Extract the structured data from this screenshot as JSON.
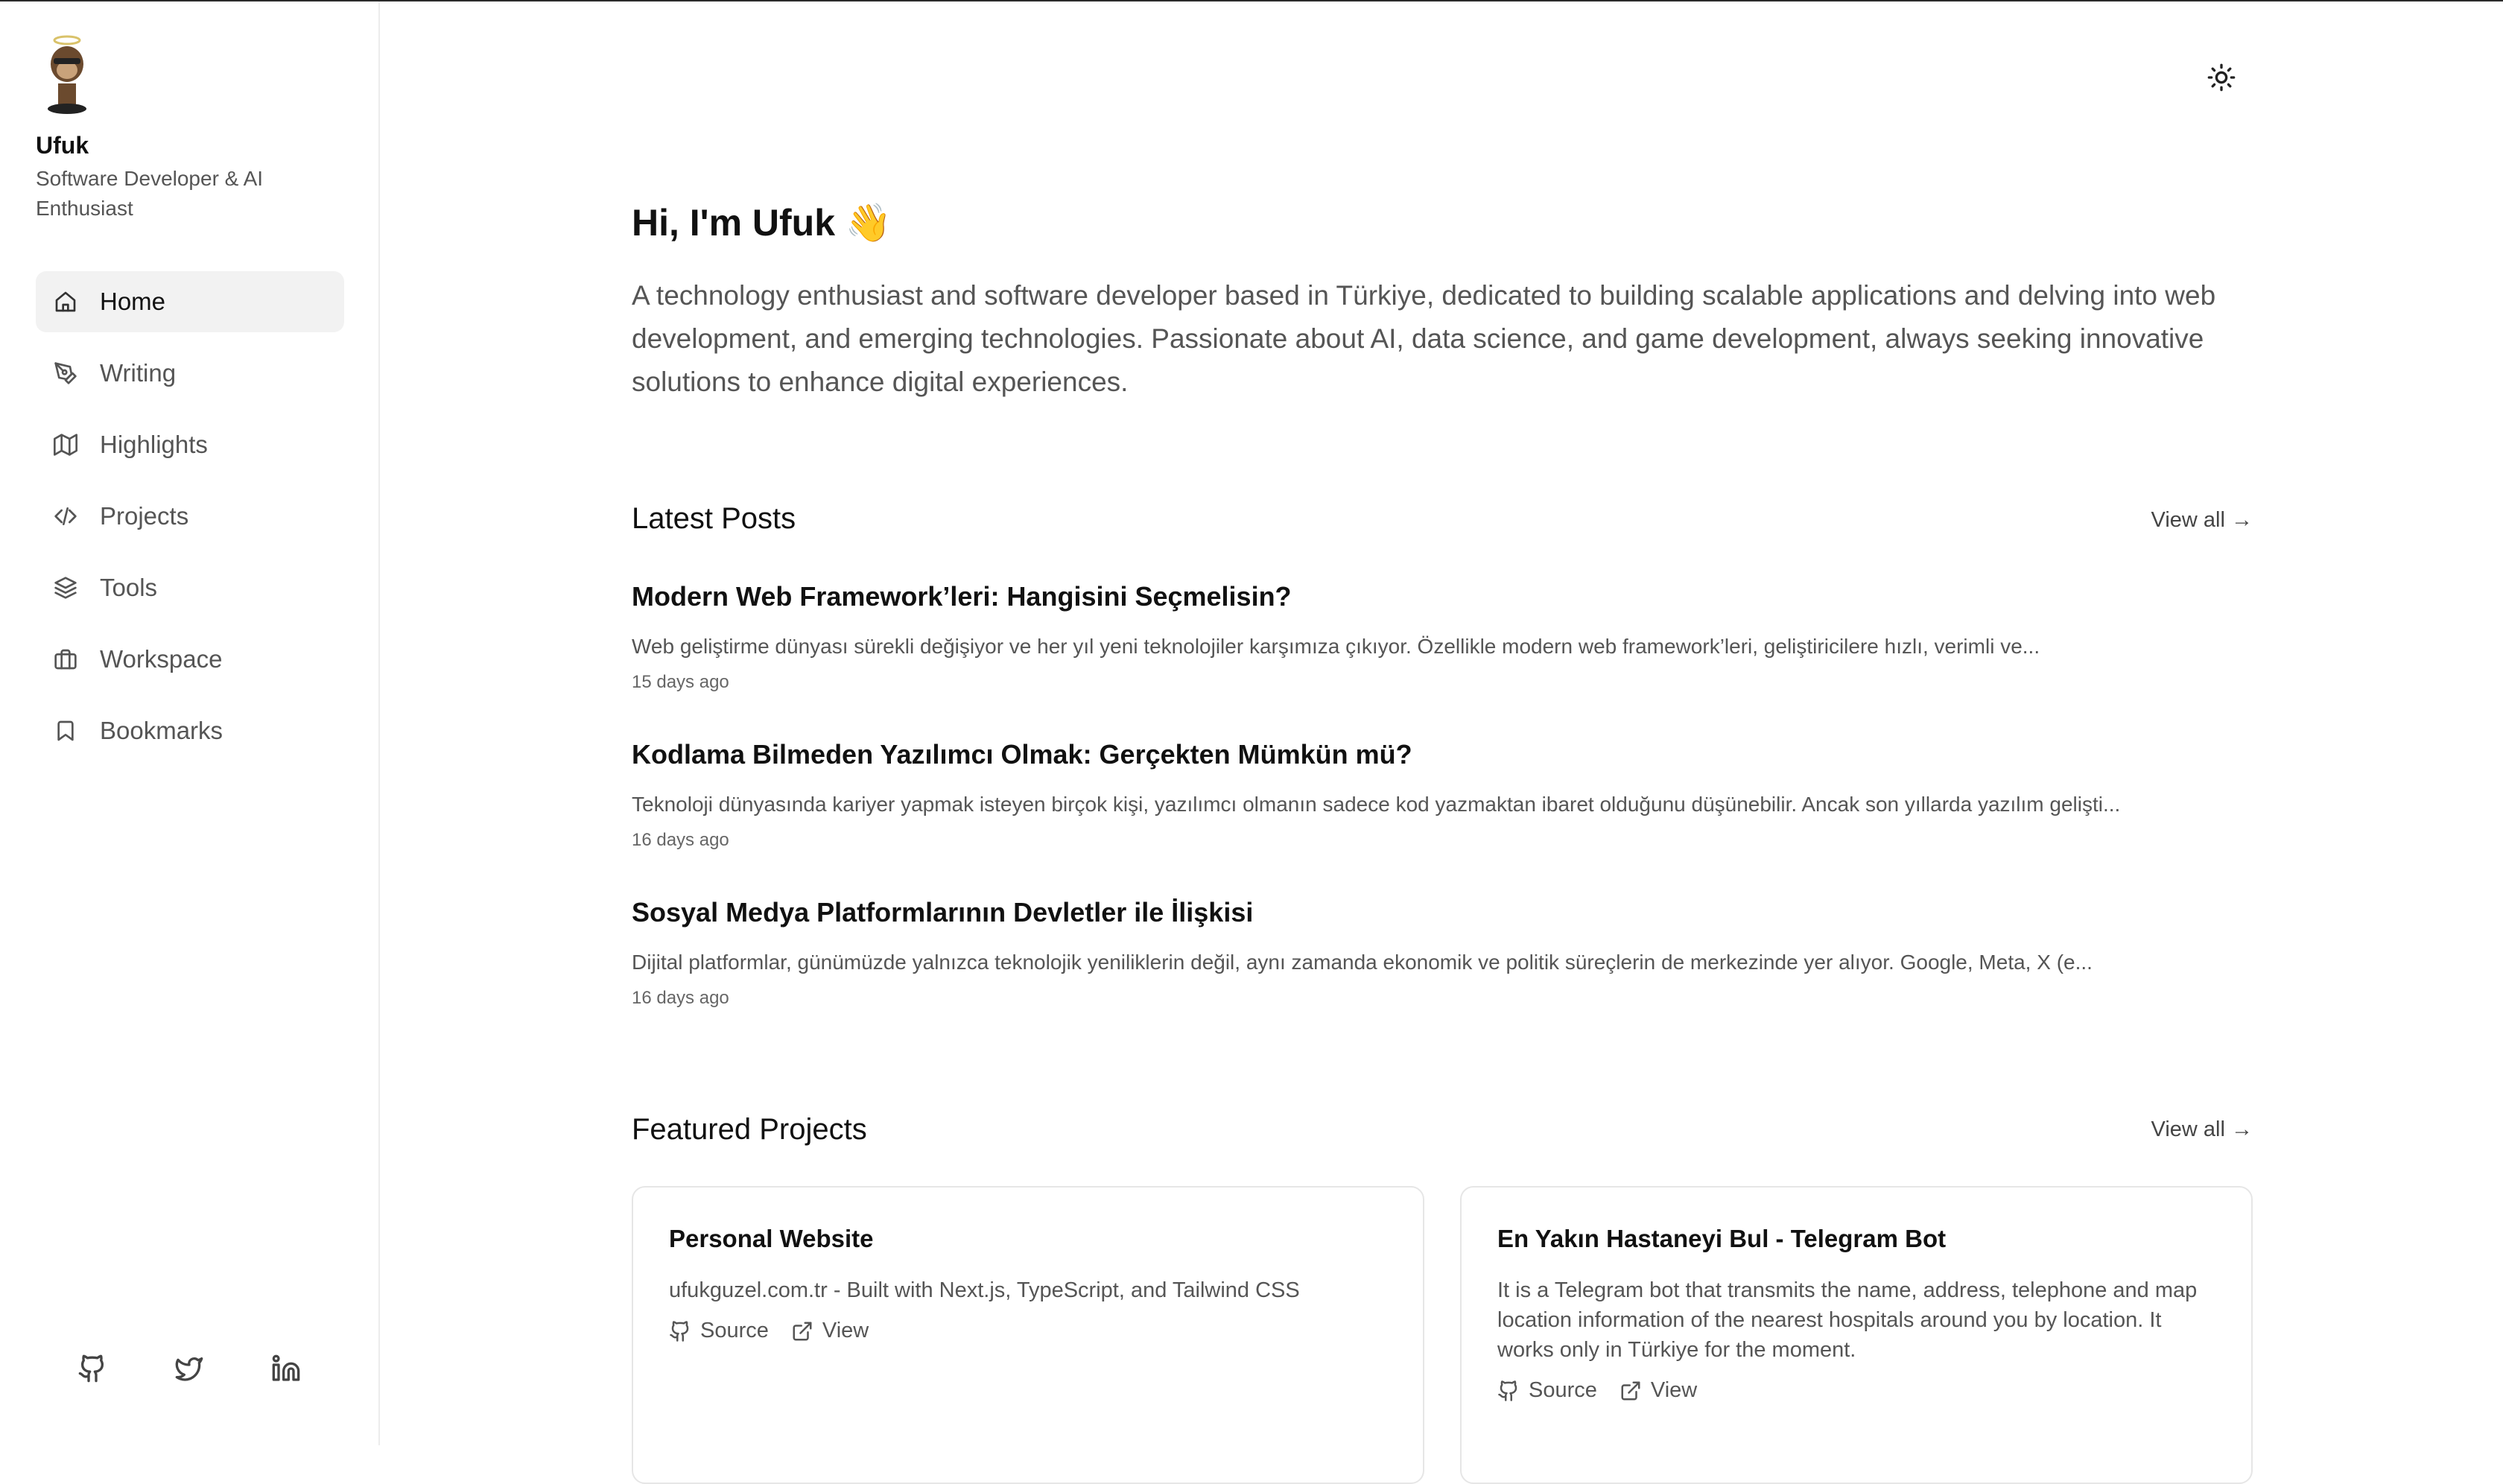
{
  "profile": {
    "name": "Ufuk",
    "role": "Software Developer & AI Enthusiast",
    "avatar_icon": "ape-avatar-icon"
  },
  "nav": {
    "items": [
      {
        "label": "Home",
        "icon": "home-icon",
        "active": true
      },
      {
        "label": "Writing",
        "icon": "pen-icon",
        "active": false
      },
      {
        "label": "Highlights",
        "icon": "map-icon",
        "active": false
      },
      {
        "label": "Projects",
        "icon": "code-icon",
        "active": false
      },
      {
        "label": "Tools",
        "icon": "layers-icon",
        "active": false
      },
      {
        "label": "Workspace",
        "icon": "briefcase-icon",
        "active": false
      },
      {
        "label": "Bookmarks",
        "icon": "bookmark-icon",
        "active": false
      }
    ]
  },
  "socials": [
    "github-icon",
    "twitter-icon",
    "linkedin-icon"
  ],
  "theme_toggle_icon": "sun-icon",
  "hero": {
    "title": "Hi, I'm Ufuk 👋",
    "text": "A technology enthusiast and software developer based in Türkiye, dedicated to building scalable applications and delving into web development, and emerging technologies. Passionate about AI, data science, and game development, always seeking innovative solutions to enhance digital experiences."
  },
  "latest_posts": {
    "title": "Latest Posts",
    "view_all": "View all →",
    "posts": [
      {
        "title": "Modern Web Framework’leri: Hangisini Seçmelisin?",
        "excerpt": "Web geliştirme dünyası sürekli değişiyor ve her yıl yeni teknolojiler karşımıza çıkıyor. Özellikle modern web framework’leri, geliştiricilere hızlı, verimli ve...",
        "date": "15 days ago"
      },
      {
        "title": "Kodlama Bilmeden Yazılımcı Olmak: Gerçekten Mümkün mü?",
        "excerpt": "Teknoloji dünyasında kariyer yapmak isteyen birçok kişi, yazılımcı olmanın sadece kod yazmaktan ibaret olduğunu düşünebilir. Ancak son yıllarda yazılım gelişti...",
        "date": "16 days ago"
      },
      {
        "title": "Sosyal Medya Platformlarının Devletler ile İlişkisi",
        "excerpt": "Dijital platformlar, günümüzde yalnızca teknolojik yeniliklerin değil, aynı zamanda ekonomik ve politik süreçlerin de merkezinde yer alıyor. Google, Meta, X (e...",
        "date": "16 days ago"
      }
    ]
  },
  "featured_projects": {
    "title": "Featured Projects",
    "view_all": "View all →",
    "projects": [
      {
        "title": "Personal Website",
        "description": "ufukguzel.com.tr - Built with Next.js, TypeScript, and Tailwind CSS",
        "source_label": "Source",
        "view_label": "View"
      },
      {
        "title": "En Yakın Hastaneyi Bul - Telegram Bot",
        "description": "It is a Telegram bot that transmits the name, address, telephone and map location information of the nearest hospitals around you by location. It works only in Türkiye for the moment.",
        "source_label": "Source",
        "view_label": "View"
      }
    ]
  }
}
